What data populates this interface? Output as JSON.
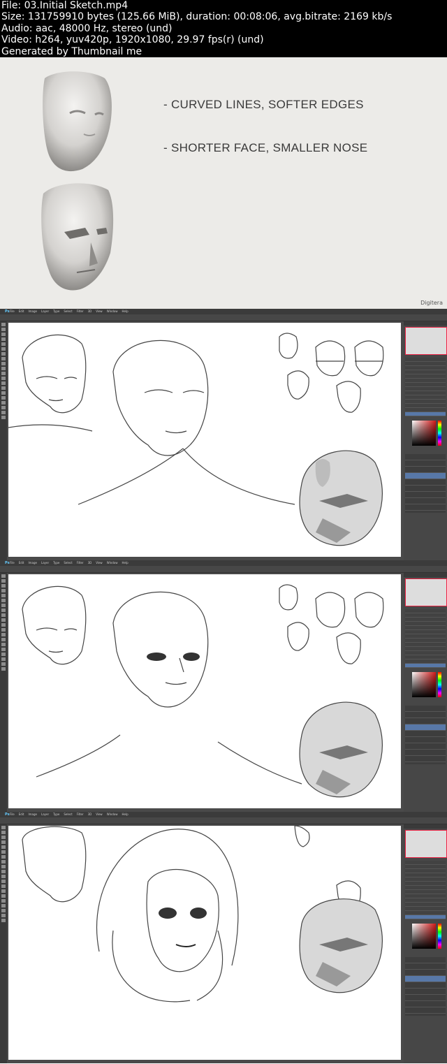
{
  "header": {
    "file": "File: 03.Initial Sketch.mp4",
    "size": "Size: 131759910 bytes (125.66 MiB), duration: 00:08:06, avg.bitrate: 2169 kb/s",
    "audio": "Audio: aac, 48000 Hz, stereo (und)",
    "video": "Video: h264, yuv420p, 1920x1080, 29.97 fps(r) (und)",
    "generated": "Generated by Thumbnail me"
  },
  "slide": {
    "bullet_1": "- CURVED LINES, SOFTER EDGES",
    "bullet_2": "- SHORTER FACE, SMALLER NOSE",
    "watermark": "Digitera"
  },
  "app": {
    "logo": "Ps",
    "menu": [
      "File",
      "Edit",
      "Image",
      "Layer",
      "Type",
      "Select",
      "Filter",
      "3D",
      "View",
      "Window",
      "Help"
    ]
  },
  "colors": {
    "slide_bg": "#ecebe8",
    "ps_chrome": "#474747",
    "layer_selected": "#5878a8"
  }
}
